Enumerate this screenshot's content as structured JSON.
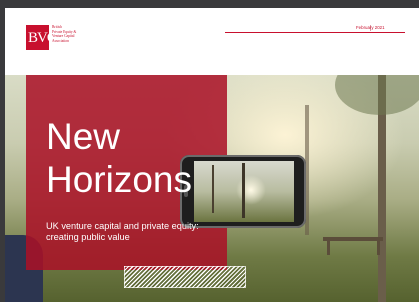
{
  "header": {
    "logo_mark": "BVCA",
    "logo_lines": [
      "British",
      "Private Equity &",
      "Venture Capital",
      "Association"
    ],
    "date": "February 2021"
  },
  "cover": {
    "title_lines": [
      "New",
      "Horizons"
    ],
    "subtitle_lines": [
      "UK venture capital and private equity:",
      "creating public value"
    ]
  },
  "colors": {
    "brand_red": "#c8102e",
    "panel_red": "#aa1026"
  }
}
